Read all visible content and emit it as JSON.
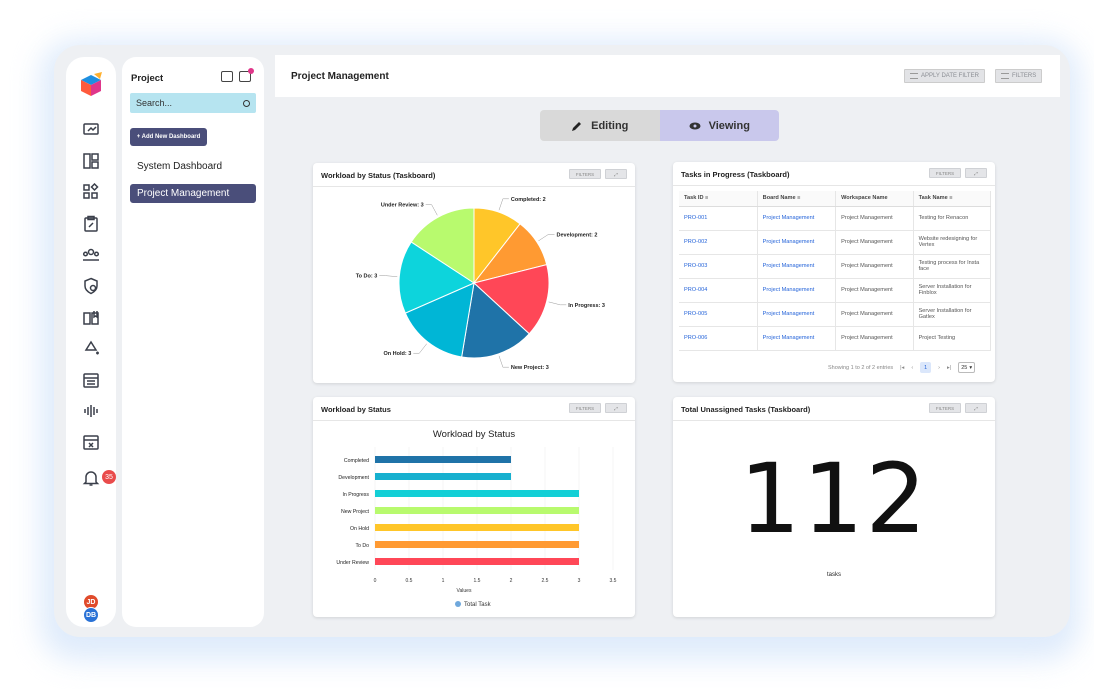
{
  "app": {
    "colors": {
      "accent": "#4a4e7a",
      "search_bg": "#b6e4f0",
      "link": "#2463d9"
    }
  },
  "rail": {
    "icons": [
      "logo-icon",
      "monitor-icon",
      "dashboard-icon",
      "apps-icon",
      "clipboard-icon",
      "team-icon",
      "shield-icon",
      "book-icon",
      "recycle-icon",
      "calendar-icon",
      "audio-icon",
      "calendar-x-icon",
      "bell-icon"
    ],
    "notification_count": "35",
    "avatars": [
      {
        "initials": "JD",
        "color": "#e04b2c"
      },
      {
        "initials": "DB",
        "color": "#2a72d6"
      }
    ]
  },
  "sidebar": {
    "title": "Project",
    "search_placeholder": "Search...",
    "add_button": "+ Add New Dashboard",
    "items": [
      {
        "label": "System Dashboard",
        "active": false
      },
      {
        "label": "Project Management",
        "active": true
      }
    ]
  },
  "header": {
    "title": "Project Management",
    "apply_date_filter": "APPLY DATE FILTER",
    "filters": "FILTERS"
  },
  "mode_toggle": {
    "editing": "Editing",
    "viewing": "Viewing",
    "selected": "viewing"
  },
  "widgets": {
    "pie": {
      "title": "Workload by Status (Taskboard)",
      "filters": "FILTERS",
      "chart_data": {
        "type": "pie",
        "slices": [
          {
            "label": "Completed",
            "value": 2,
            "text": "Completed: 2",
            "color": "#ffc629"
          },
          {
            "label": "Development",
            "value": 2,
            "text": "Development: 2",
            "color": "#ff9a32"
          },
          {
            "label": "In Progress",
            "value": 3,
            "text": "In Progress: 3",
            "color": "#ff4757"
          },
          {
            "label": "New Project",
            "value": 3,
            "text": "New Project: 3",
            "color": "#1f73a8"
          },
          {
            "label": "On Hold",
            "value": 3,
            "text": "On Hold: 3",
            "color": "#00b6d6"
          },
          {
            "label": "To Do",
            "value": 3,
            "text": "To Do: 3",
            "color": "#0dd4dc"
          },
          {
            "label": "Under Review",
            "value": 3,
            "text": "Under Review: 3",
            "color": "#b8fa6e"
          }
        ]
      }
    },
    "table": {
      "title": "Tasks in Progress (Taskboard)",
      "filters": "FILTERS",
      "columns": [
        "Task ID",
        "Board Name",
        "Workspace Name",
        "Task Name"
      ],
      "rows": [
        [
          "PRO-001",
          "Project Management",
          "Project Management",
          "Testing for Renacon"
        ],
        [
          "PRO-002",
          "Project Management",
          "Project Management",
          "Website redesigning for Vertex"
        ],
        [
          "PRO-003",
          "Project Management",
          "Project Management",
          "Testing process for Insta face"
        ],
        [
          "PRO-004",
          "Project Management",
          "Project Management",
          "Server Installation for Finblox"
        ],
        [
          "PRO-005",
          "Project Management",
          "Project Management",
          "Server Installation for Gatlex"
        ],
        [
          "PRO-006",
          "Project Management",
          "Project Management",
          "Project Testing"
        ]
      ],
      "pager": {
        "summary": "Showing 1 to 2 of 2 entries",
        "current_page": "1",
        "page_size": "25"
      }
    },
    "bar": {
      "title": "Workload by Status",
      "filters": "FILTERS",
      "chart_data": {
        "type": "bar",
        "orientation": "horizontal",
        "title": "Workload by Status",
        "categories": [
          "Completed",
          "Development",
          "In Progress",
          "New Project",
          "On Hold",
          "To Do",
          "Under Review"
        ],
        "series": [
          {
            "name": "Total Task",
            "values": [
              2,
              2,
              3,
              3,
              3,
              3,
              3
            ]
          }
        ],
        "bar_colors": [
          "#1f73a8",
          "#16b0cf",
          "#13cfd6",
          "#b8fa6e",
          "#ffc629",
          "#ff9a32",
          "#ff4757"
        ],
        "xlabel": "Values",
        "xlim": [
          0,
          3.5
        ],
        "xticks": [
          "0",
          "0.5",
          "1",
          "1.5",
          "2",
          "2.5",
          "3",
          "3.5"
        ],
        "legend": "bottom",
        "legend_color": "#6fa8dc"
      }
    },
    "number": {
      "title": "Total Unassigned Tasks (Taskboard)",
      "filters": "FILTERS",
      "value": "112",
      "label": "tasks"
    }
  }
}
